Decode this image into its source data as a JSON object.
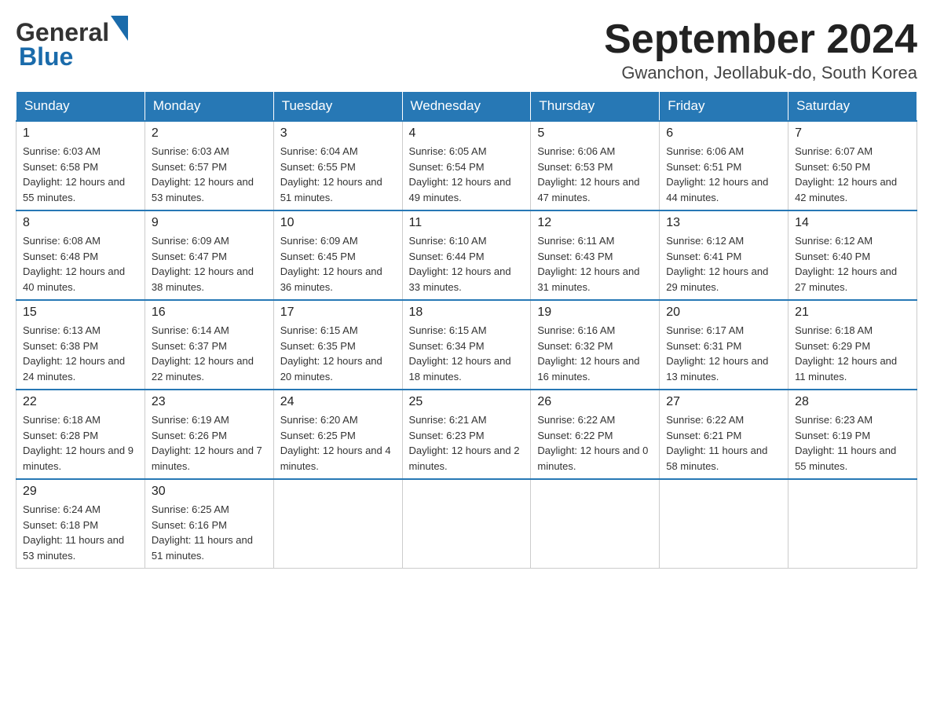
{
  "header": {
    "logo_text_general": "General",
    "logo_text_blue": "Blue",
    "month_title": "September 2024",
    "location": "Gwanchon, Jeollabuk-do, South Korea"
  },
  "days_of_week": [
    "Sunday",
    "Monday",
    "Tuesday",
    "Wednesday",
    "Thursday",
    "Friday",
    "Saturday"
  ],
  "weeks": [
    [
      {
        "day": "1",
        "sunrise": "6:03 AM",
        "sunset": "6:58 PM",
        "daylight": "12 hours and 55 minutes."
      },
      {
        "day": "2",
        "sunrise": "6:03 AM",
        "sunset": "6:57 PM",
        "daylight": "12 hours and 53 minutes."
      },
      {
        "day": "3",
        "sunrise": "6:04 AM",
        "sunset": "6:55 PM",
        "daylight": "12 hours and 51 minutes."
      },
      {
        "day": "4",
        "sunrise": "6:05 AM",
        "sunset": "6:54 PM",
        "daylight": "12 hours and 49 minutes."
      },
      {
        "day": "5",
        "sunrise": "6:06 AM",
        "sunset": "6:53 PM",
        "daylight": "12 hours and 47 minutes."
      },
      {
        "day": "6",
        "sunrise": "6:06 AM",
        "sunset": "6:51 PM",
        "daylight": "12 hours and 44 minutes."
      },
      {
        "day": "7",
        "sunrise": "6:07 AM",
        "sunset": "6:50 PM",
        "daylight": "12 hours and 42 minutes."
      }
    ],
    [
      {
        "day": "8",
        "sunrise": "6:08 AM",
        "sunset": "6:48 PM",
        "daylight": "12 hours and 40 minutes."
      },
      {
        "day": "9",
        "sunrise": "6:09 AM",
        "sunset": "6:47 PM",
        "daylight": "12 hours and 38 minutes."
      },
      {
        "day": "10",
        "sunrise": "6:09 AM",
        "sunset": "6:45 PM",
        "daylight": "12 hours and 36 minutes."
      },
      {
        "day": "11",
        "sunrise": "6:10 AM",
        "sunset": "6:44 PM",
        "daylight": "12 hours and 33 minutes."
      },
      {
        "day": "12",
        "sunrise": "6:11 AM",
        "sunset": "6:43 PM",
        "daylight": "12 hours and 31 minutes."
      },
      {
        "day": "13",
        "sunrise": "6:12 AM",
        "sunset": "6:41 PM",
        "daylight": "12 hours and 29 minutes."
      },
      {
        "day": "14",
        "sunrise": "6:12 AM",
        "sunset": "6:40 PM",
        "daylight": "12 hours and 27 minutes."
      }
    ],
    [
      {
        "day": "15",
        "sunrise": "6:13 AM",
        "sunset": "6:38 PM",
        "daylight": "12 hours and 24 minutes."
      },
      {
        "day": "16",
        "sunrise": "6:14 AM",
        "sunset": "6:37 PM",
        "daylight": "12 hours and 22 minutes."
      },
      {
        "day": "17",
        "sunrise": "6:15 AM",
        "sunset": "6:35 PM",
        "daylight": "12 hours and 20 minutes."
      },
      {
        "day": "18",
        "sunrise": "6:15 AM",
        "sunset": "6:34 PM",
        "daylight": "12 hours and 18 minutes."
      },
      {
        "day": "19",
        "sunrise": "6:16 AM",
        "sunset": "6:32 PM",
        "daylight": "12 hours and 16 minutes."
      },
      {
        "day": "20",
        "sunrise": "6:17 AM",
        "sunset": "6:31 PM",
        "daylight": "12 hours and 13 minutes."
      },
      {
        "day": "21",
        "sunrise": "6:18 AM",
        "sunset": "6:29 PM",
        "daylight": "12 hours and 11 minutes."
      }
    ],
    [
      {
        "day": "22",
        "sunrise": "6:18 AM",
        "sunset": "6:28 PM",
        "daylight": "12 hours and 9 minutes."
      },
      {
        "day": "23",
        "sunrise": "6:19 AM",
        "sunset": "6:26 PM",
        "daylight": "12 hours and 7 minutes."
      },
      {
        "day": "24",
        "sunrise": "6:20 AM",
        "sunset": "6:25 PM",
        "daylight": "12 hours and 4 minutes."
      },
      {
        "day": "25",
        "sunrise": "6:21 AM",
        "sunset": "6:23 PM",
        "daylight": "12 hours and 2 minutes."
      },
      {
        "day": "26",
        "sunrise": "6:22 AM",
        "sunset": "6:22 PM",
        "daylight": "12 hours and 0 minutes."
      },
      {
        "day": "27",
        "sunrise": "6:22 AM",
        "sunset": "6:21 PM",
        "daylight": "11 hours and 58 minutes."
      },
      {
        "day": "28",
        "sunrise": "6:23 AM",
        "sunset": "6:19 PM",
        "daylight": "11 hours and 55 minutes."
      }
    ],
    [
      {
        "day": "29",
        "sunrise": "6:24 AM",
        "sunset": "6:18 PM",
        "daylight": "11 hours and 53 minutes."
      },
      {
        "day": "30",
        "sunrise": "6:25 AM",
        "sunset": "6:16 PM",
        "daylight": "11 hours and 51 minutes."
      },
      null,
      null,
      null,
      null,
      null
    ]
  ]
}
